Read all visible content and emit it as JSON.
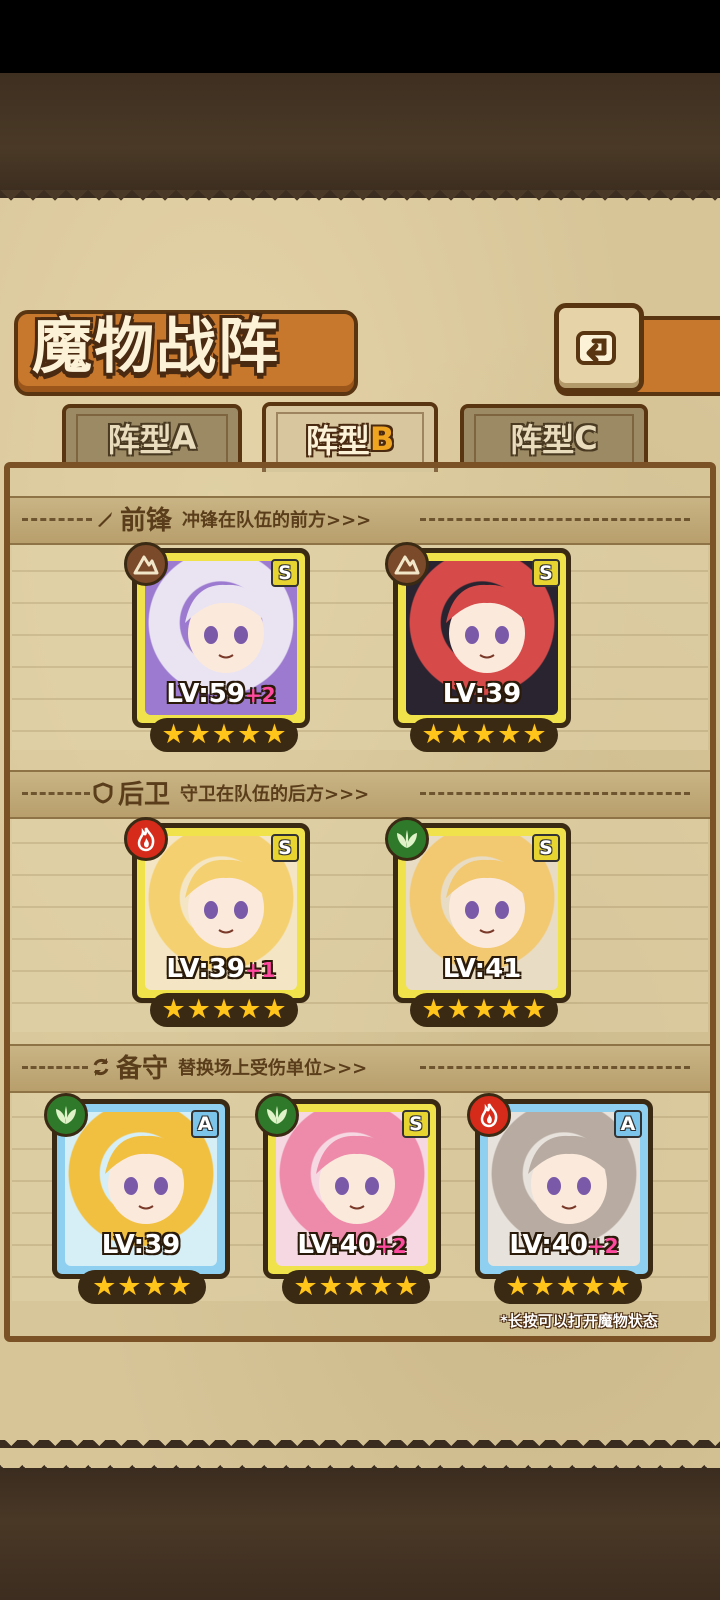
{
  "title": "魔物战阵",
  "tabs": [
    {
      "label": "阵型",
      "suffix": "A",
      "active": false
    },
    {
      "label": "阵型",
      "suffix": "B",
      "active": true
    },
    {
      "label": "阵型",
      "suffix": "C",
      "active": false
    }
  ],
  "sections": {
    "vanguard": {
      "name": "前锋",
      "desc": "冲锋在队伍的前方>>>",
      "icon": "sword-icon"
    },
    "rearguard": {
      "name": "后卫",
      "desc": "守卫在队伍的后方>>>",
      "icon": "shield-icon"
    },
    "reserve": {
      "name": "备守",
      "desc": "替换场上受伤单位>>>",
      "icon": "swap-icon"
    }
  },
  "cards": [
    {
      "rank": "S",
      "element": "earth",
      "level": "LV:59",
      "plus": "+2",
      "stars": "★★★★★",
      "palette": [
        "#9b7ad0",
        "#e9e3f2"
      ]
    },
    {
      "rank": "S",
      "element": "earth",
      "level": "LV:39",
      "plus": "",
      "stars": "★★★★★",
      "palette": [
        "#2a2430",
        "#d64a4a"
      ]
    },
    {
      "rank": "S",
      "element": "fire",
      "level": "LV:39",
      "plus": "+1",
      "stars": "★★★★★",
      "palette": [
        "#f4e6c4",
        "#f5d070"
      ]
    },
    {
      "rank": "S",
      "element": "nature",
      "level": "LV:41",
      "plus": "",
      "stars": "★★★★★",
      "palette": [
        "#e8dcc4",
        "#f2c870"
      ]
    },
    {
      "rank": "A",
      "element": "nature",
      "level": "LV:39",
      "plus": "",
      "stars": "★★★★",
      "palette": [
        "#d6eef5",
        "#f2c040"
      ]
    },
    {
      "rank": "S",
      "element": "nature",
      "level": "LV:40",
      "plus": "+2",
      "stars": "★★★★★",
      "palette": [
        "#f5d8e2",
        "#ee8aaa"
      ]
    },
    {
      "rank": "A",
      "element": "fire",
      "level": "LV:40",
      "plus": "+2",
      "stars": "★★★★★",
      "palette": [
        "#e8e2dc",
        "#b8aca2"
      ]
    }
  ],
  "footnote": "*长按可以打开魔物状态",
  "colors": {
    "earth": "#7a4a2a",
    "fire": "#d62a1a",
    "nature": "#2f7a2a",
    "rank_s": "#f0e24a",
    "rank_a": "#8fd0f0"
  }
}
